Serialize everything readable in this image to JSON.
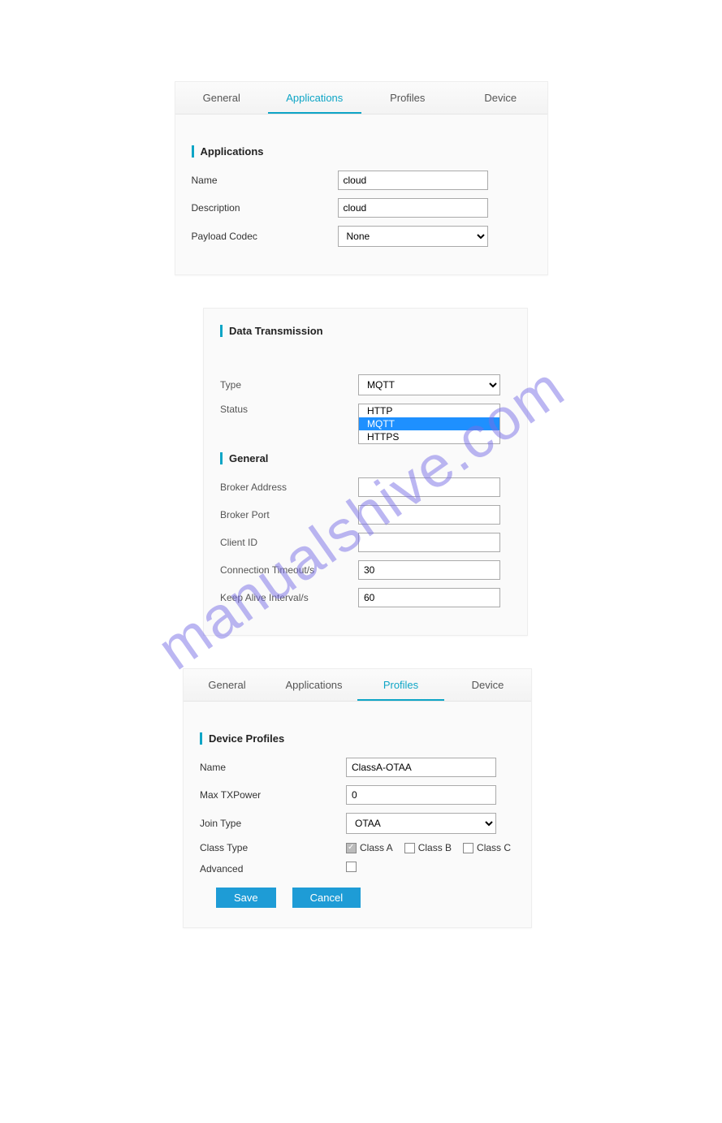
{
  "watermark": "manualshive.com",
  "panel1": {
    "tabs": [
      "General",
      "Applications",
      "Profiles",
      "Device"
    ],
    "active_index": 1,
    "title": "Applications",
    "name_label": "Name",
    "name_value": "cloud",
    "description_label": "Description",
    "description_value": "cloud",
    "payload_label": "Payload Codec",
    "payload_value": "None"
  },
  "panel2": {
    "title1": "Data Transmission",
    "type_label": "Type",
    "type_value": "MQTT",
    "status_label": "Status",
    "dropdown_options": [
      "HTTP",
      "MQTT",
      "HTTPS"
    ],
    "dropdown_selected_index": 1,
    "title2": "General",
    "broker_addr_label": "Broker Address",
    "broker_addr_value": "",
    "broker_port_label": "Broker Port",
    "broker_port_value": "",
    "client_id_label": "Client ID",
    "client_id_value": "",
    "conn_timeout_label": "Connection Timeout/s",
    "conn_timeout_value": "30",
    "keepalive_label": "Keep Alive Interval/s",
    "keepalive_value": "60"
  },
  "panel3": {
    "tabs": [
      "General",
      "Applications",
      "Profiles",
      "Device"
    ],
    "active_index": 2,
    "title": "Device Profiles",
    "name_label": "Name",
    "name_value": "ClassA-OTAA",
    "txpower_label": "Max TXPower",
    "txpower_value": "0",
    "join_label": "Join Type",
    "join_value": "OTAA",
    "class_label": "Class Type",
    "class_a": "Class A",
    "class_b": "Class B",
    "class_c": "Class C",
    "class_a_checked": true,
    "class_b_checked": false,
    "class_c_checked": false,
    "advanced_label": "Advanced",
    "advanced_checked": false,
    "save_label": "Save",
    "cancel_label": "Cancel"
  }
}
